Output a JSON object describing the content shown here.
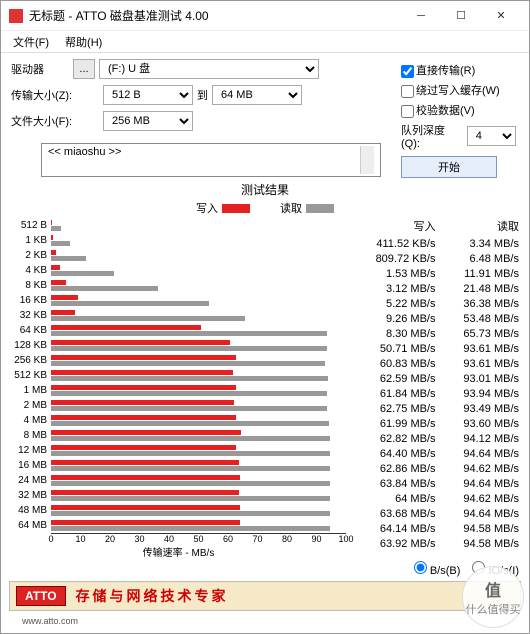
{
  "window": {
    "title": "无标题 - ATTO 磁盘基准测试 4.00"
  },
  "menu": {
    "file": "文件(F)",
    "help": "帮助(H)"
  },
  "labels": {
    "drive": "驱动器",
    "dots": "...",
    "drive_val": "(F:) U 盘",
    "xfer": "传输大小(Z):",
    "xfer_from": "512 B",
    "to": "到",
    "xfer_to": "64 MB",
    "filesize": "文件大小(F):",
    "filesize_val": "256 MB"
  },
  "opts": {
    "direct": "直接传输(R)",
    "bypass": "绕过写入缓存(W)",
    "verify": "校验数据(V)",
    "depth_lbl": "队列深度(Q):",
    "depth_val": "4",
    "start": "开始"
  },
  "desc": {
    "text": "<< miaoshu >>"
  },
  "chart": {
    "title": "测试结果",
    "legend_w": "写入",
    "legend_r": "读取",
    "xlabel": "传输速率 - MB/s",
    "xmax": 100,
    "ticks": [
      "0",
      "10",
      "20",
      "30",
      "40",
      "50",
      "60",
      "70",
      "80",
      "90",
      "100"
    ]
  },
  "table": {
    "hdr_w": "写入",
    "hdr_r": "读取"
  },
  "unit": {
    "bs": "B/s(B)",
    "ios": "IO/s(I)"
  },
  "footer": {
    "logo": "ATTO",
    "slogan": "存储与网络技术专家",
    "url": "www.atto.com"
  },
  "watermark": {
    "big": "值",
    "small": "什么值得买"
  },
  "chart_data": {
    "type": "bar",
    "xlabel": "传输速率 - MB/s",
    "xlim": [
      0,
      100
    ],
    "series": [
      {
        "name": "写入",
        "color": "#e62020"
      },
      {
        "name": "读取",
        "color": "#999"
      }
    ],
    "rows": [
      {
        "label": "512 B",
        "w_txt": "411.52 KB/s",
        "r_txt": "3.34 MB/s",
        "w": 0.41,
        "r": 3.34
      },
      {
        "label": "1 KB",
        "w_txt": "809.72 KB/s",
        "r_txt": "6.48 MB/s",
        "w": 0.81,
        "r": 6.48
      },
      {
        "label": "2 KB",
        "w_txt": "1.53 MB/s",
        "r_txt": "11.91 MB/s",
        "w": 1.53,
        "r": 11.91
      },
      {
        "label": "4 KB",
        "w_txt": "3.12 MB/s",
        "r_txt": "21.48 MB/s",
        "w": 3.12,
        "r": 21.48
      },
      {
        "label": "8 KB",
        "w_txt": "5.22 MB/s",
        "r_txt": "36.38 MB/s",
        "w": 5.22,
        "r": 36.38
      },
      {
        "label": "16 KB",
        "w_txt": "9.26 MB/s",
        "r_txt": "53.48 MB/s",
        "w": 9.26,
        "r": 53.48
      },
      {
        "label": "32 KB",
        "w_txt": "8.30 MB/s",
        "r_txt": "65.73 MB/s",
        "w": 8.3,
        "r": 65.73
      },
      {
        "label": "64 KB",
        "w_txt": "50.71 MB/s",
        "r_txt": "93.61 MB/s",
        "w": 50.71,
        "r": 93.61
      },
      {
        "label": "128 KB",
        "w_txt": "60.83 MB/s",
        "r_txt": "93.61 MB/s",
        "w": 60.83,
        "r": 93.61
      },
      {
        "label": "256 KB",
        "w_txt": "62.59 MB/s",
        "r_txt": "93.01 MB/s",
        "w": 62.59,
        "r": 93.01
      },
      {
        "label": "512 KB",
        "w_txt": "61.84 MB/s",
        "r_txt": "93.94 MB/s",
        "w": 61.84,
        "r": 93.94
      },
      {
        "label": "1 MB",
        "w_txt": "62.75 MB/s",
        "r_txt": "93.49 MB/s",
        "w": 62.75,
        "r": 93.49
      },
      {
        "label": "2 MB",
        "w_txt": "61.99 MB/s",
        "r_txt": "93.60 MB/s",
        "w": 61.99,
        "r": 93.6
      },
      {
        "label": "4 MB",
        "w_txt": "62.82 MB/s",
        "r_txt": "94.12 MB/s",
        "w": 62.82,
        "r": 94.12
      },
      {
        "label": "8 MB",
        "w_txt": "64.40 MB/s",
        "r_txt": "94.64 MB/s",
        "w": 64.4,
        "r": 94.64
      },
      {
        "label": "12 MB",
        "w_txt": "62.86 MB/s",
        "r_txt": "94.62 MB/s",
        "w": 62.86,
        "r": 94.62
      },
      {
        "label": "16 MB",
        "w_txt": "63.84 MB/s",
        "r_txt": "94.64 MB/s",
        "w": 63.84,
        "r": 94.64
      },
      {
        "label": "24 MB",
        "w_txt": "64 MB/s",
        "r_txt": "94.62 MB/s",
        "w": 64.0,
        "r": 94.62
      },
      {
        "label": "32 MB",
        "w_txt": "63.68 MB/s",
        "r_txt": "94.64 MB/s",
        "w": 63.68,
        "r": 94.64
      },
      {
        "label": "48 MB",
        "w_txt": "64.14 MB/s",
        "r_txt": "94.58 MB/s",
        "w": 64.14,
        "r": 94.58
      },
      {
        "label": "64 MB",
        "w_txt": "63.92 MB/s",
        "r_txt": "94.58 MB/s",
        "w": 63.92,
        "r": 94.58
      }
    ]
  }
}
